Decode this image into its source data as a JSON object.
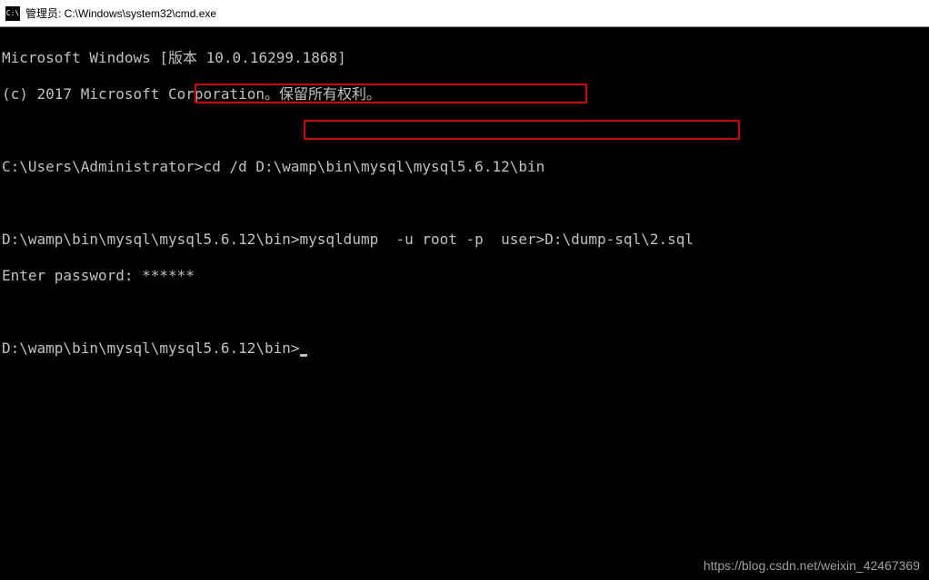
{
  "titlebar": {
    "icon_label": "C:\\",
    "title": "管理员: C:\\Windows\\system32\\cmd.exe"
  },
  "terminal": {
    "line1": "Microsoft Windows [版本 10.0.16299.1868]",
    "line2": "(c) 2017 Microsoft Corporation。保留所有权利。",
    "prompt1": "C:\\Users\\Administrator>",
    "cmd1": "cd /d D:\\wamp\\bin\\mysql\\mysql5.6.12\\bin",
    "prompt2": "D:\\wamp\\bin\\mysql\\mysql5.6.12\\bin>",
    "cmd2": "mysqldump  -u root -p  user>D:\\dump-sql\\2.sql",
    "passline_label": "Enter password: ",
    "passline_mask": "******",
    "prompt3": "D:\\wamp\\bin\\mysql\\mysql5.6.12\\bin>"
  },
  "watermark": "https://blog.csdn.net/weixin_42467369"
}
